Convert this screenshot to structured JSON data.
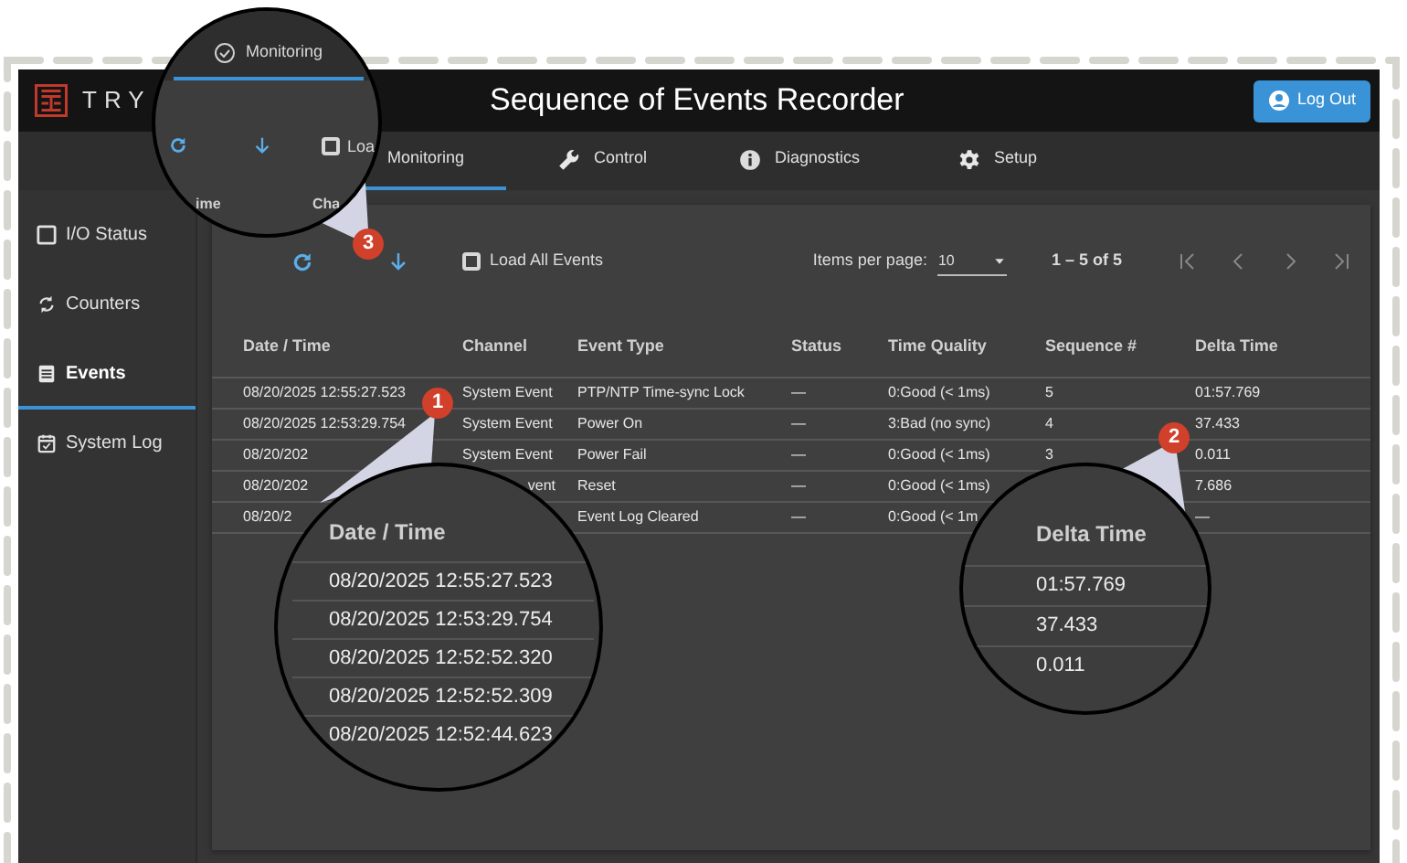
{
  "header": {
    "logo_text": "TRY",
    "title": "Sequence of Events Recorder",
    "logout_button": "Log Out"
  },
  "nav_tabs": [
    {
      "label": "Monitoring",
      "selected": true,
      "icon": false
    },
    {
      "label": "Control",
      "selected": false,
      "icon": true
    },
    {
      "label": "Diagnostics",
      "selected": false,
      "icon": true
    },
    {
      "label": "Setup",
      "selected": false,
      "icon": true
    }
  ],
  "sidebar": {
    "items": [
      {
        "label": "I/O Status",
        "selected": false
      },
      {
        "label": "Counters",
        "selected": false
      },
      {
        "label": "Events",
        "selected": true
      },
      {
        "label": "System Log",
        "selected": false
      }
    ]
  },
  "toolbar": {
    "load_all_events": {
      "label": "Load All Events",
      "checked": false
    },
    "items_per_page_label": "Items per page:",
    "items_per_page": "10",
    "range": "1 – 5 of 5"
  },
  "table": {
    "columns": [
      "Date / Time",
      "Channel",
      "Event Type",
      "Status",
      "Time Quality",
      "Sequence #",
      "Delta Time"
    ],
    "rows": [
      {
        "cells": [
          "08/20/2025 12:55:27.523",
          "System Event",
          "PTP/NTP Time-sync Lock",
          "—",
          "0:Good (< 1ms)",
          "5",
          "01:57.769"
        ]
      },
      {
        "cells": [
          "08/20/2025 12:53:29.754",
          "System Event",
          "Power On",
          "—",
          "3:Bad (no sync)",
          "4",
          "37.433"
        ]
      },
      {
        "cells": [
          "08/20/202",
          "System Event",
          "Power Fail",
          "—",
          "0:Good (< 1ms)",
          "3",
          "0.011"
        ]
      },
      {
        "cells": [
          "08/20/202",
          "vent",
          "Reset",
          "—",
          "0:Good (< 1ms)",
          null,
          "7.686"
        ]
      },
      {
        "cells": [
          "08/20/2",
          null,
          "Event Log Cleared",
          "—",
          "0:Good (< 1m",
          null,
          "—"
        ]
      }
    ]
  },
  "callouts": [
    {
      "number": "1",
      "kind": "dates",
      "header": "Date / Time",
      "rows": [
        "08/20/2025 12:55:27.523",
        "08/20/2025 12:53:29.754",
        "08/20/2025 12:52:52.320",
        "08/20/2025 12:52:52.309",
        "08/20/2025 12:52:44.623"
      ]
    },
    {
      "number": "2",
      "kind": "delta",
      "header": "Delta Time",
      "rows": [
        "01:57.769",
        "37.433",
        "0.011"
      ]
    },
    {
      "number": "3",
      "kind": "toolbar",
      "tab": {
        "label": "Monitoring",
        "selected": true
      },
      "checkbox": {
        "label": "Loa",
        "checked": false
      },
      "fragments": [
        "ime",
        "Cha"
      ]
    }
  ]
}
